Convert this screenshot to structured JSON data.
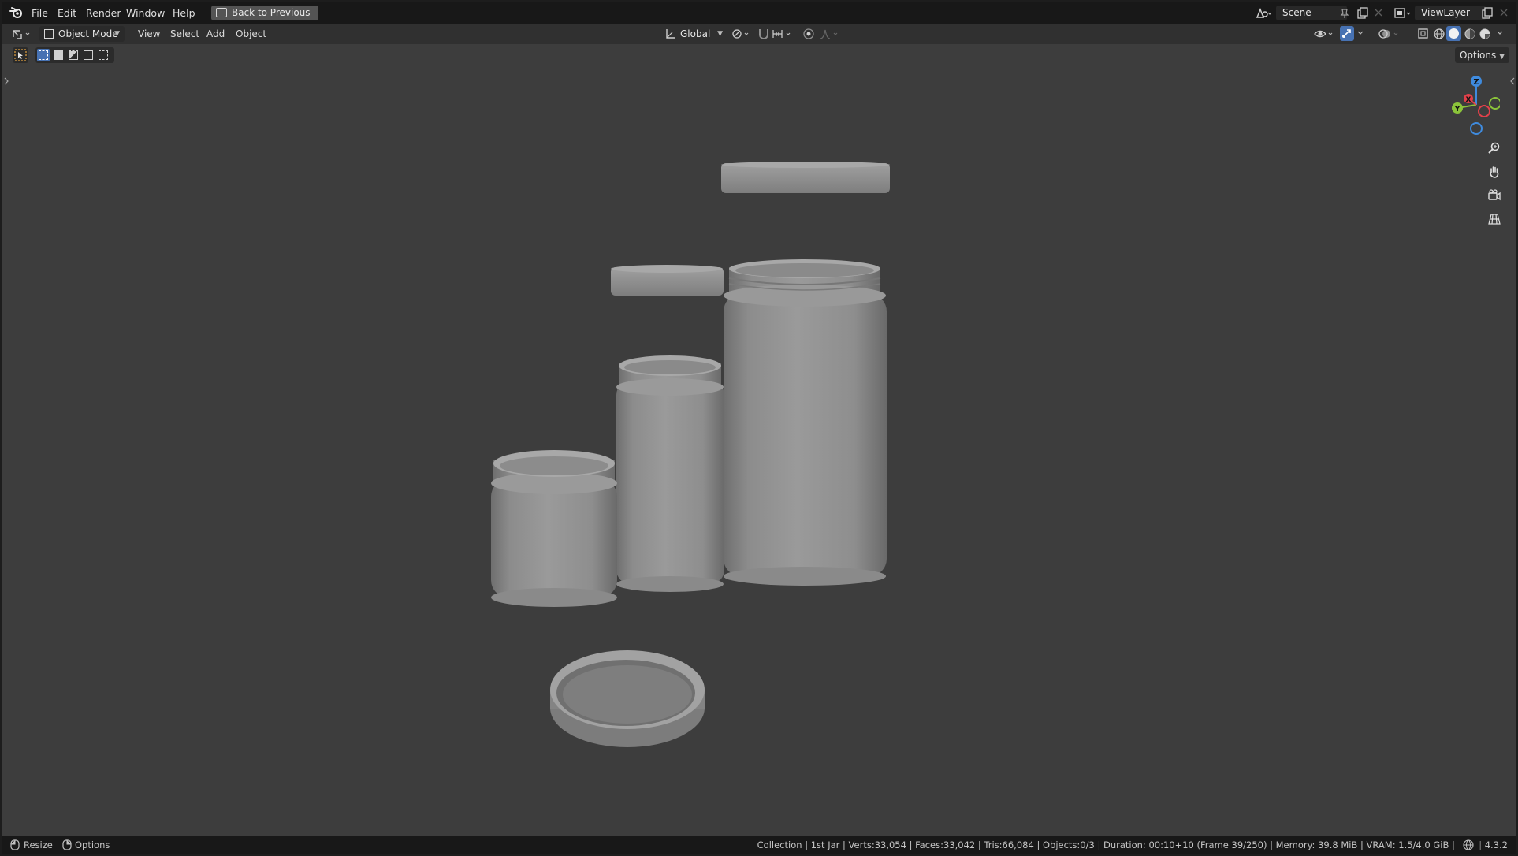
{
  "menubar": {
    "items": [
      "File",
      "Edit",
      "Render",
      "Window",
      "Help"
    ],
    "back_button": "Back to Previous",
    "scene": "Scene",
    "view_layer": "ViewLayer"
  },
  "header": {
    "mode": "Object Mode",
    "menus": [
      "View",
      "Select",
      "Add",
      "Object"
    ],
    "orientation": "Global",
    "options": "Options"
  },
  "gizmo": {
    "axis_z": "Z",
    "axis_y": "Y",
    "axis_x": "X"
  },
  "statusbar": {
    "left_resize": "Resize",
    "left_options": "Options",
    "info": "Collection | 1st Jar | Verts:33,054 | Faces:33,042 | Tris:66,084 | Objects:0/3 | Duration: 00:10+10 (Frame 39/250) | Memory: 39.8 MiB | VRAM: 1.5/4.0 GiB |",
    "version": "4.3.2"
  },
  "colors": {
    "viewport_bg": "#3d3d3d",
    "axis_x": "#e3404a",
    "axis_y": "#8bc43a",
    "axis_z": "#3f8bde",
    "active_tool": "#4772b3"
  }
}
